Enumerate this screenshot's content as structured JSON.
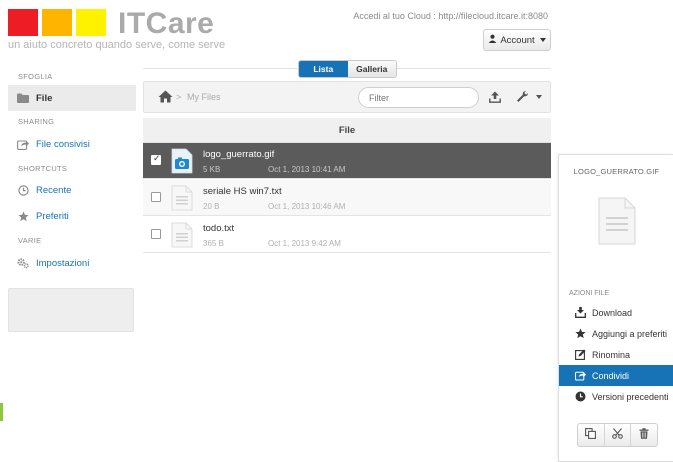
{
  "brand": {
    "logo_text": "ITCare",
    "tagline": "un aiuto concreto quando serve, come serve",
    "colors": {
      "red": "#ee1c25",
      "orange": "#ffb400",
      "yellow": "#fff200"
    }
  },
  "header": {
    "cloud_link": "Accedi al tuo Cloud : http://filecloud.itcare.it:8080",
    "account_label": "Account"
  },
  "view_toggle": {
    "list_label": "Lista",
    "gallery_label": "Galleria",
    "active": "Lista"
  },
  "sidebar": {
    "sections": [
      {
        "title": "SFOGLIA",
        "items": [
          {
            "label": "File",
            "icon": "folder-icon",
            "active": true
          }
        ]
      },
      {
        "title": "SHARING",
        "items": [
          {
            "label": "File consivisi",
            "icon": "share-icon",
            "active": false
          }
        ]
      },
      {
        "title": "SHORTCUTS",
        "items": [
          {
            "label": "Recente",
            "icon": "clock-icon",
            "active": false
          },
          {
            "label": "Preferiti",
            "icon": "star-icon",
            "active": false
          }
        ]
      },
      {
        "title": "VARIE",
        "items": [
          {
            "label": "Impostazioni",
            "icon": "gears-icon",
            "active": false
          }
        ]
      }
    ]
  },
  "toolbar": {
    "breadcrumb_sep": ">",
    "breadcrumb": "My Files",
    "filter_placeholder": "Filter"
  },
  "table": {
    "header": "File",
    "rows": [
      {
        "name": "logo_guerrato.gif",
        "size": "5 KB",
        "date": "Oct 1, 2013 10:41 AM",
        "selected": true,
        "icon": "image-file-icon"
      },
      {
        "name": "seriale HS win7.txt",
        "size": "20 B",
        "date": "Oct 1, 2013 10:46 AM",
        "selected": false,
        "icon": "text-file-icon"
      },
      {
        "name": "todo.txt",
        "size": "365 B",
        "date": "Oct 1, 2013 9:42 AM",
        "selected": false,
        "icon": "text-file-icon"
      }
    ]
  },
  "panel": {
    "title": "LOGO_GUERRATO.GIF",
    "section_title": "AZIONI FILE",
    "actions": [
      {
        "label": "Download",
        "icon": "download-icon",
        "active": false
      },
      {
        "label": "Aggiungi a preferiti",
        "icon": "star-icon",
        "active": false
      },
      {
        "label": "Rinomina",
        "icon": "rename-icon",
        "active": false
      },
      {
        "label": "Condividi",
        "icon": "share-icon",
        "active": true
      },
      {
        "label": "Versioni precedenti",
        "icon": "history-icon",
        "active": false
      }
    ],
    "buttons": [
      "copy-icon",
      "cut-icon",
      "trash-icon"
    ]
  },
  "accent_color": "#1773b5"
}
